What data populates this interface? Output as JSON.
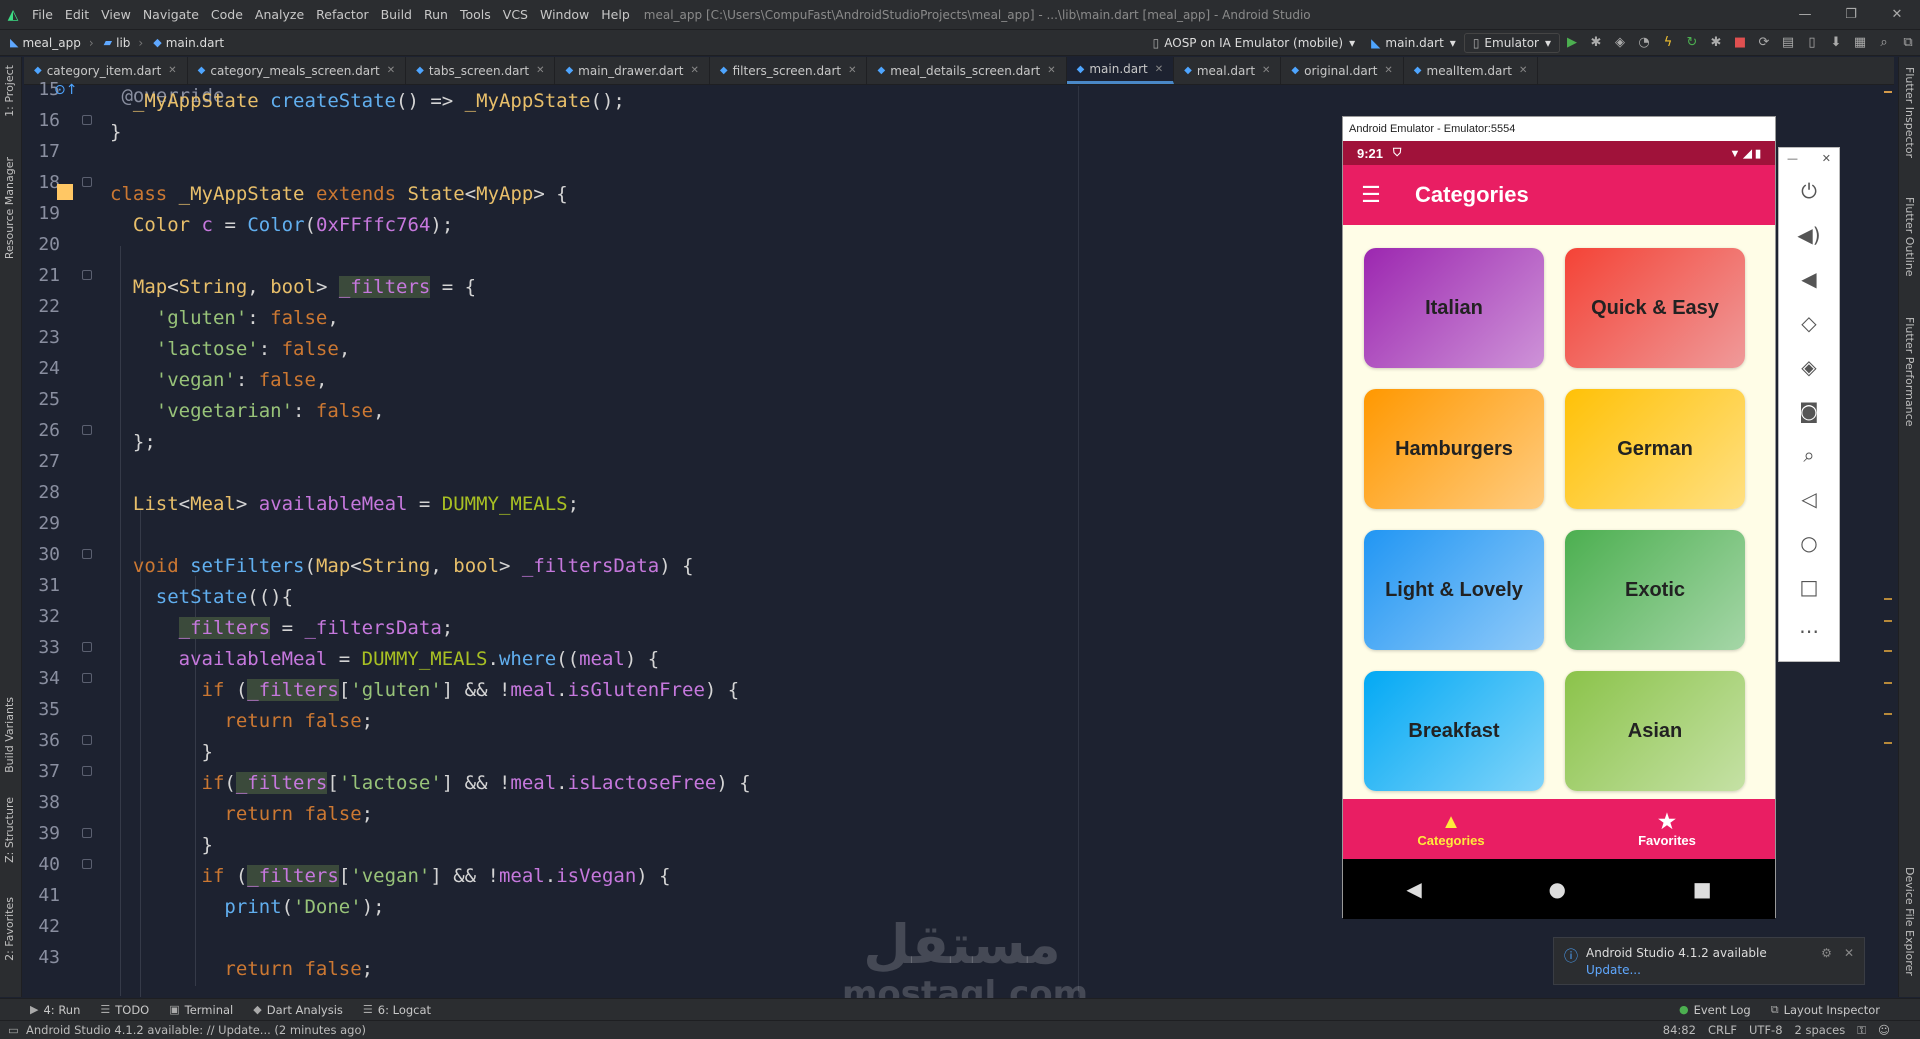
{
  "menubar": {
    "items": [
      "File",
      "Edit",
      "View",
      "Navigate",
      "Code",
      "Analyze",
      "Refactor",
      "Build",
      "Run",
      "Tools",
      "VCS",
      "Window",
      "Help"
    ],
    "window_title": "meal_app [C:\\Users\\CompuFast\\AndroidStudioProjects\\meal_app] - ...\\lib\\main.dart [meal_app] - Android Studio",
    "controls": [
      "—",
      "❐",
      "✕"
    ]
  },
  "navbar": {
    "crumbs": [
      "meal_app",
      "lib",
      "main.dart"
    ],
    "device": "AOSP on IA Emulator (mobile)",
    "config": "main.dart",
    "emulator": "Emulator"
  },
  "tabs": [
    {
      "label": "category_item.dart"
    },
    {
      "label": "category_meals_screen.dart"
    },
    {
      "label": "tabs_screen.dart"
    },
    {
      "label": "main_drawer.dart"
    },
    {
      "label": "filters_screen.dart"
    },
    {
      "label": "meal_details_screen.dart"
    },
    {
      "label": "main.dart",
      "active": true
    },
    {
      "label": "meal.dart"
    },
    {
      "label": "original.dart"
    },
    {
      "label": "mealItem.dart"
    }
  ],
  "leftbar": [
    "1: Project",
    "Resource Manager",
    "Build Variants",
    "Z: Structure",
    "2: Favorites"
  ],
  "rightbar": [
    "Flutter Inspector",
    "Flutter Outline",
    "Flutter Performance",
    "Device File Explorer"
  ],
  "code_lines": [
    15,
    16,
    17,
    18,
    19,
    20,
    21,
    22,
    23,
    24,
    25,
    26,
    27,
    28,
    29,
    30,
    31,
    32,
    33,
    34,
    35,
    36,
    37,
    38,
    39,
    40,
    41,
    42,
    43
  ],
  "emulator": {
    "window_title": "Android Emulator - Emulator:5554",
    "time": "9:21",
    "app_title": "Categories",
    "categories": [
      {
        "name": "Italian",
        "c1": "#9c27b0",
        "c2": "#ce93d8"
      },
      {
        "name": "Quick & Easy",
        "c1": "#f44336",
        "c2": "#ef9a9a"
      },
      {
        "name": "Hamburgers",
        "c1": "#ff9800",
        "c2": "#ffcc80"
      },
      {
        "name": "German",
        "c1": "#ffc107",
        "c2": "#ffe082"
      },
      {
        "name": "Light & Lovely",
        "c1": "#2196f3",
        "c2": "#90caf9"
      },
      {
        "name": "Exotic",
        "c1": "#4caf50",
        "c2": "#a5d6a7"
      },
      {
        "name": "Breakfast",
        "c1": "#03a9f4",
        "c2": "#81d4fa"
      },
      {
        "name": "Asian",
        "c1": "#8bc34a",
        "c2": "#c5e1a5"
      }
    ],
    "bottom_nav": [
      {
        "label": "Categories",
        "icon": "category-icon",
        "selected": true
      },
      {
        "label": "Favorites",
        "icon": "star-icon",
        "selected": false
      }
    ]
  },
  "notification": {
    "title": "Android Studio 4.1.2 available",
    "link": "Update..."
  },
  "toolwindows": [
    {
      "label": "4: Run",
      "icon": "▶"
    },
    {
      "label": "TODO",
      "icon": "☰"
    },
    {
      "label": "Terminal",
      "icon": "▣"
    },
    {
      "label": "Dart Analysis",
      "icon": "◆"
    },
    {
      "label": "6: Logcat",
      "icon": "☰"
    }
  ],
  "toolwindows_right": [
    {
      "label": "Event Log",
      "icon": "●"
    },
    {
      "label": "Layout Inspector",
      "icon": "⧉"
    }
  ],
  "status": {
    "message": "Android Studio 4.1.2 available: // Update... (2 minutes ago)",
    "position": "84:82",
    "line_sep": "CRLF",
    "encoding": "UTF-8",
    "indent": "2 spaces"
  },
  "watermark": {
    "arabic": "مستقل",
    "latin": "mostaql.com"
  }
}
